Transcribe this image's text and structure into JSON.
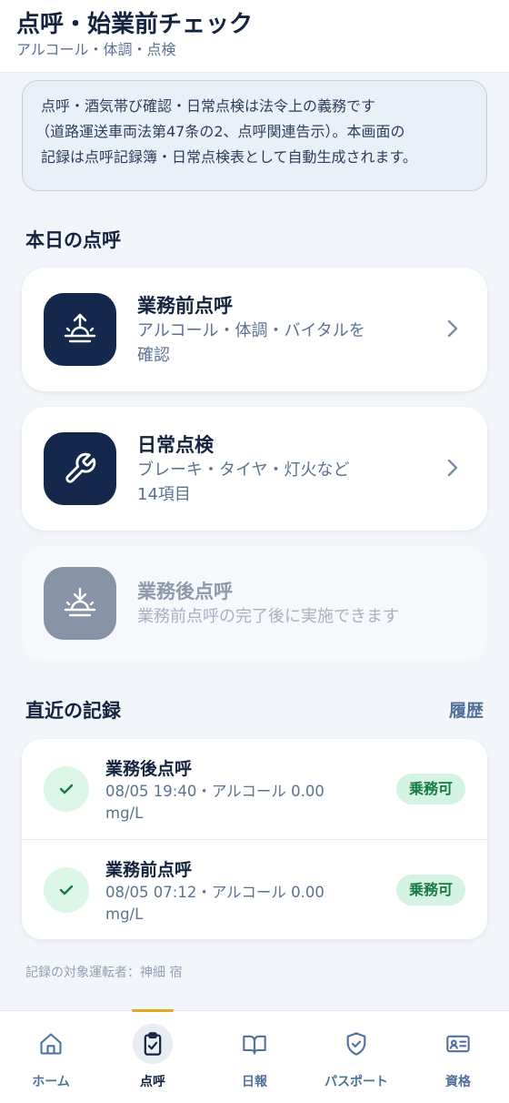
{
  "header": {
    "title": "点呼・始業前チェック",
    "subtitle": "アルコール・体調・点検"
  },
  "notice": {
    "lines": [
      "点呼・酒気帯び確認・日常点検は法令上の義務です",
      "（道路運送車両法第47条の2、点呼関連告示）。本画面の",
      "記録は点呼記録簿・日常点検表として自動生成されます。"
    ]
  },
  "today": {
    "title": "本日の点呼",
    "cards": [
      {
        "title": "業務前点呼",
        "desc_lines": [
          "アルコール・体調・バイタルを",
          "確認"
        ],
        "icon": "sunrise-icon",
        "enabled": true
      },
      {
        "title": "日常点検",
        "desc_lines": [
          "ブレーキ・タイヤ・灯火など",
          "14項目"
        ],
        "icon": "wrench-icon",
        "enabled": true
      },
      {
        "title": "業務後点呼",
        "desc_lines": [
          "業務前点呼の完了後に実施できます"
        ],
        "icon": "sunset-icon",
        "enabled": false
      }
    ]
  },
  "recent": {
    "title": "直近の記録",
    "history_link": "履歴",
    "records": [
      {
        "title": "業務後点呼",
        "meta_lines": [
          "08/05 19:40・アルコール 0.00",
          "mg/L"
        ],
        "badge": "乗務可"
      },
      {
        "title": "業務前点呼",
        "meta_lines": [
          "08/05 07:12・アルコール 0.00",
          "mg/L"
        ],
        "badge": "乗務可"
      }
    ]
  },
  "footnote": "記録の対象運転者：神細 宿",
  "tabs": [
    {
      "label": "ホーム",
      "icon": "home-icon",
      "active": false
    },
    {
      "label": "点呼",
      "icon": "clipboard-check-icon",
      "active": true
    },
    {
      "label": "日報",
      "icon": "book-icon",
      "active": false
    },
    {
      "label": "パスポート",
      "icon": "shield-check-icon",
      "active": false
    },
    {
      "label": "資格",
      "icon": "id-card-icon",
      "active": false
    }
  ],
  "colors": {
    "navy": "#14284b",
    "accent": "#e6a51e",
    "success": "#157a46",
    "muted": "#5b7293"
  }
}
